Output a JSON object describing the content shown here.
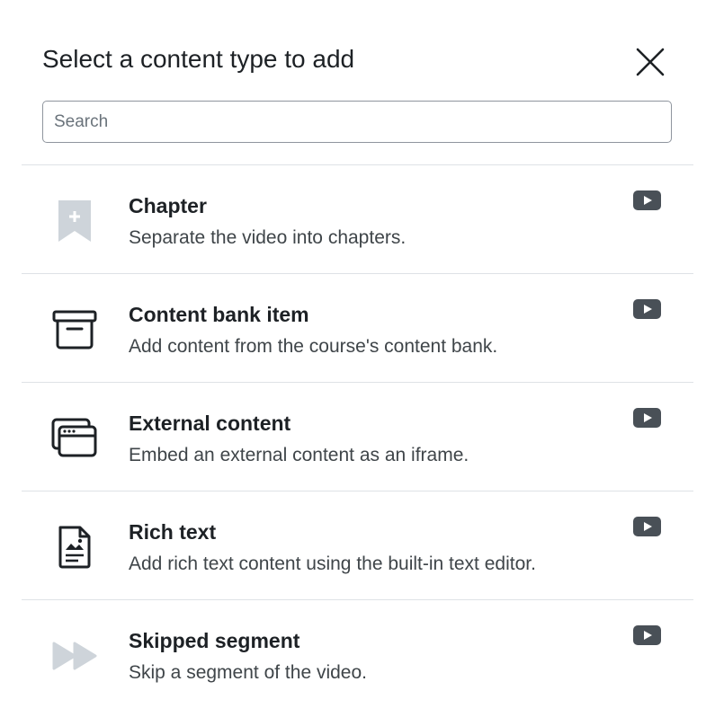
{
  "modal": {
    "title": "Select a content type to add",
    "close_label": "Close"
  },
  "search": {
    "placeholder": "Search",
    "value": ""
  },
  "items": [
    {
      "title": "Chapter",
      "description": "Separate the video into chapters.",
      "icon": "bookmark-plus-icon",
      "badge_icon": "video-play-icon"
    },
    {
      "title": "Content bank item",
      "description": "Add content from the course's content bank.",
      "icon": "archive-box-icon",
      "badge_icon": "video-play-icon"
    },
    {
      "title": "External content",
      "description": "Embed an external content as an iframe.",
      "icon": "browser-windows-icon",
      "badge_icon": "video-play-icon"
    },
    {
      "title": "Rich text",
      "description": "Add rich text content using the built-in text editor.",
      "icon": "document-image-icon",
      "badge_icon": "video-play-icon"
    },
    {
      "title": "Skipped segment",
      "description": "Skip a segment of the video.",
      "icon": "fast-forward-icon",
      "badge_icon": "video-play-icon"
    }
  ],
  "colors": {
    "icon_dark": "#1d2125",
    "icon_light": "#ced4da",
    "badge": "#495057",
    "divider": "#dee2e6"
  }
}
